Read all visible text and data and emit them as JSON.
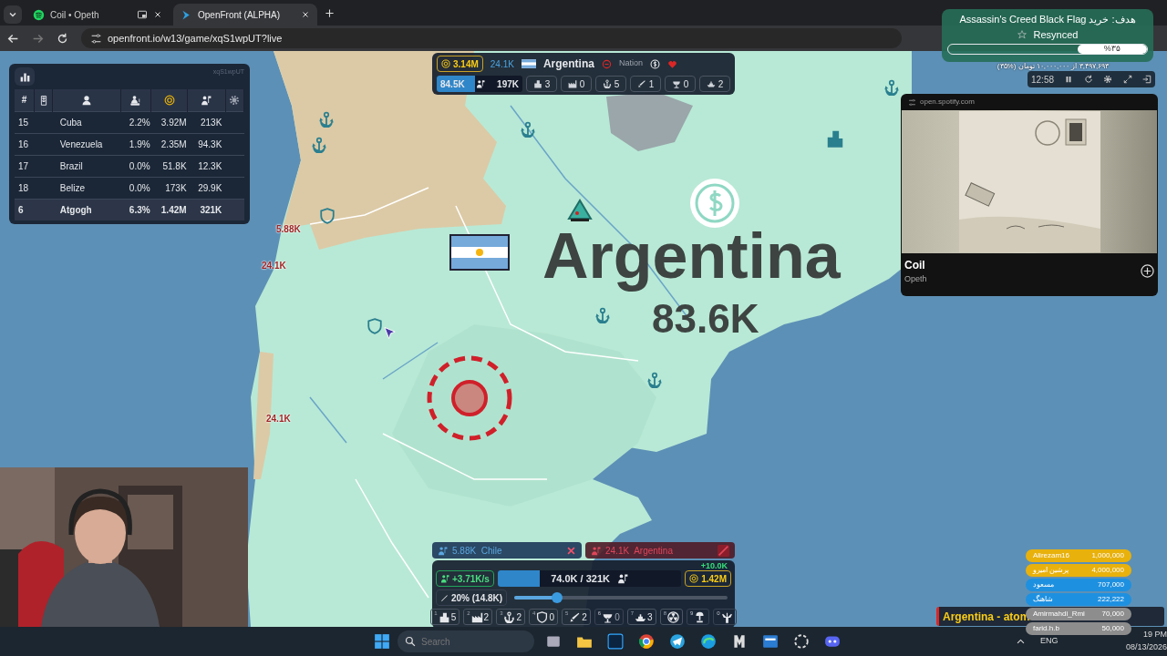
{
  "browser": {
    "tabs": [
      {
        "title": "Coil • Opeth",
        "kind": "music",
        "selected": false
      },
      {
        "title": "OpenFront (ALPHA)",
        "kind": "game",
        "selected": true
      }
    ],
    "url": "openfront.io/w13/game/xqS1wpUT?live"
  },
  "leaderboard": {
    "game_id": "xqS1wpUT",
    "columns": [
      {
        "kind": "rank",
        "label": "#"
      },
      {
        "kind": "alliance"
      },
      {
        "kind": "player"
      },
      {
        "kind": "territory"
      },
      {
        "kind": "gold"
      },
      {
        "kind": "troops"
      }
    ],
    "rows": [
      {
        "rank": "15",
        "name": "Cuba",
        "territory": "2.2%",
        "gold": "3.92M",
        "troops": "213K",
        "selected": false
      },
      {
        "rank": "16",
        "name": "Venezuela",
        "territory": "1.9%",
        "gold": "2.35M",
        "troops": "94.3K",
        "selected": false
      },
      {
        "rank": "17",
        "name": "Brazil",
        "territory": "0.0%",
        "gold": "51.8K",
        "troops": "12.3K",
        "selected": false
      },
      {
        "rank": "18",
        "name": "Belize",
        "territory": "0.0%",
        "gold": "173K",
        "troops": "29.9K",
        "selected": false
      },
      {
        "rank": "6",
        "name": "Atgogh",
        "territory": "6.3%",
        "gold": "1.42M",
        "troops": "321K",
        "selected": true
      }
    ]
  },
  "player_info": {
    "gold": "3.14M",
    "troops": "24.1K",
    "name": "Argentina",
    "type": "Nation",
    "attack_troops": "84.5K",
    "max_troops": "197K",
    "level": 0.45,
    "buildings": [
      {
        "kind": "city",
        "count": "3"
      },
      {
        "kind": "factory",
        "count": "0"
      },
      {
        "kind": "port",
        "count": "5"
      },
      {
        "kind": "missile",
        "count": "1"
      },
      {
        "kind": "sam",
        "count": "0"
      },
      {
        "kind": "warship",
        "count": "2"
      }
    ]
  },
  "map": {
    "country_name": "Argentina",
    "country_troops": "83.6K",
    "troop_labels": [
      "5.88K",
      "24.1K",
      "24.1K"
    ]
  },
  "attacks": [
    {
      "troops": "5.88K",
      "target": "Chile",
      "kind": "outgoing"
    },
    {
      "troops": "24.1K",
      "target": "Argentina",
      "kind": "incoming"
    }
  ],
  "control_panel": {
    "gain": "+10.0K",
    "rate": "+3.71K/s",
    "troops": "74.0K / 321K",
    "level": 0.23,
    "gold": "1.42M",
    "attack_ratio": {
      "text": "20% (14.8K)",
      "level": 0.2
    },
    "build": [
      {
        "key": "1",
        "kind": "city",
        "count": "5",
        "disabled": false
      },
      {
        "key": "2",
        "kind": "factory",
        "count": "2",
        "disabled": false
      },
      {
        "key": "3",
        "kind": "port",
        "count": "2",
        "disabled": false
      },
      {
        "key": "4",
        "kind": "defense",
        "count": "0",
        "disabled": false
      },
      {
        "key": "5",
        "kind": "missile",
        "count": "2",
        "disabled": false
      },
      {
        "key": "6",
        "kind": "sam",
        "count": "0",
        "disabled": true
      },
      {
        "key": "7",
        "kind": "warship",
        "count": "3",
        "disabled": false
      },
      {
        "key": "8",
        "kind": "nuke",
        "disabled": false
      },
      {
        "key": "9",
        "kind": "hydrogen",
        "disabled": true
      },
      {
        "key": "0",
        "kind": "mirv",
        "disabled": true
      }
    ]
  },
  "spotify": {
    "domain": "open.spotify.com",
    "track": "Coil",
    "artist": "Opeth"
  },
  "donation_goal": {
    "title": "هدف: خرید Assassin's Creed Black Flag",
    "status": "Resynced",
    "percent": "%۳۵",
    "level": 0.35,
    "amount": "۳,۴۹۷,۶۹۳ از ۱۰,۰۰۰,۰۰۰ تومان (%۳۵)",
    "time": "12:58"
  },
  "donors": [
    {
      "name": "Alirezam16",
      "amount": "1,000,000",
      "color": "#e8b10c"
    },
    {
      "name": "پرشین امیرو",
      "amount": "4,000,000",
      "color": "#e8b10c"
    },
    {
      "name": "مسعود",
      "amount": "707,000",
      "color": "#1e90e0"
    },
    {
      "name": "شاهنگ",
      "amount": "222,222",
      "color": "#1e90e0"
    },
    {
      "name": "Amirmahdi_Rmi",
      "amount": "70,000",
      "color": "#8d8d8d"
    },
    {
      "name": "farid.h.b",
      "amount": "50,000",
      "color": "#8d8d8d"
    }
  ],
  "alert": {
    "text": "Argentina - atom"
  },
  "taskbar": {
    "search": {
      "placeholder": "Search"
    },
    "language": "ENG",
    "time": "19 PM",
    "date": "08/13/2026"
  }
}
